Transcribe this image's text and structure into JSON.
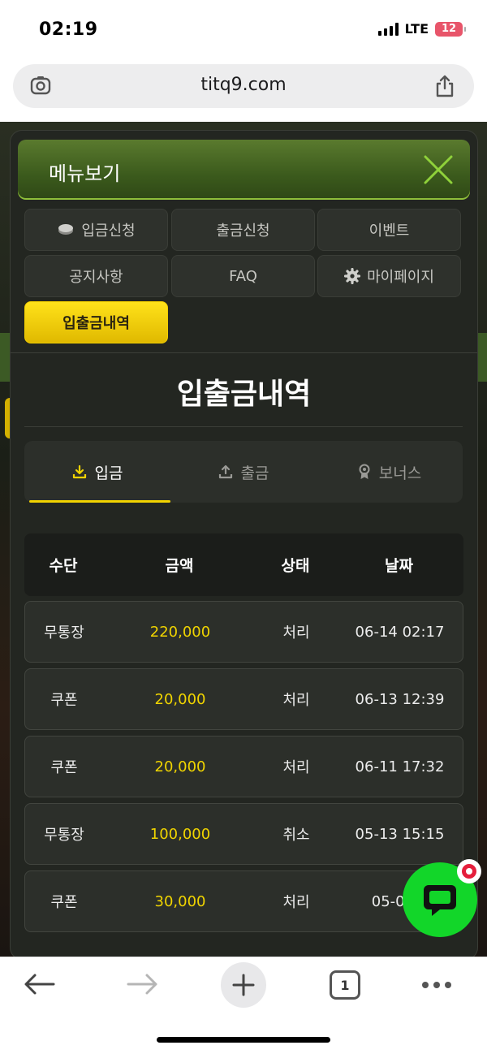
{
  "status_bar": {
    "time": "02:19",
    "network": "LTE",
    "battery": "12"
  },
  "browser": {
    "url": "titq9.com"
  },
  "menu": {
    "title": "메뉴보기",
    "items": [
      {
        "label": "입금신청",
        "icon": "coin-icon"
      },
      {
        "label": "출금신청",
        "icon": ""
      },
      {
        "label": "이벤트",
        "icon": ""
      },
      {
        "label": "공지사항",
        "icon": ""
      },
      {
        "label": "FAQ",
        "icon": ""
      },
      {
        "label": "마이페이지",
        "icon": "gear-icon"
      },
      {
        "label": "입출금내역",
        "icon": "",
        "active": true
      }
    ]
  },
  "section": {
    "title": "입출금내역"
  },
  "tabs": [
    {
      "label": "입금",
      "icon": "download-icon",
      "active": true
    },
    {
      "label": "출금",
      "icon": "upload-icon",
      "active": false
    },
    {
      "label": "보너스",
      "icon": "badge-icon",
      "active": false
    }
  ],
  "table": {
    "headers": [
      "수단",
      "금액",
      "상태",
      "날짜"
    ],
    "rows": [
      {
        "method": "무통장",
        "amount": "220,000",
        "status": "처리",
        "date": "06-14 02:17"
      },
      {
        "method": "쿠폰",
        "amount": "20,000",
        "status": "처리",
        "date": "06-13 12:39"
      },
      {
        "method": "쿠폰",
        "amount": "20,000",
        "status": "처리",
        "date": "06-11 17:32"
      },
      {
        "method": "무통장",
        "amount": "100,000",
        "status": "취소",
        "date": "05-13 15:15"
      },
      {
        "method": "쿠폰",
        "amount": "30,000",
        "status": "처리",
        "date": "05-04 1"
      }
    ]
  },
  "toolbar": {
    "tab_count": "1"
  },
  "colors": {
    "accent_yellow": "#f2d300",
    "header_green": "#3b5a1c",
    "chat_green": "#12d629",
    "panel_bg": "#232621"
  }
}
